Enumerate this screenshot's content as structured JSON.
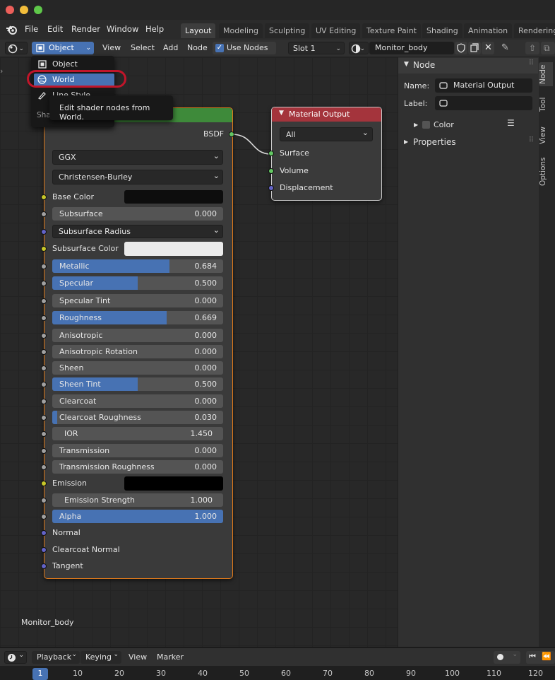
{
  "menubar": {
    "items": [
      "File",
      "Edit",
      "Render",
      "Window",
      "Help"
    ]
  },
  "workspaces": [
    "Layout",
    "Modeling",
    "Sculpting",
    "UV Editing",
    "Texture Paint",
    "Shading",
    "Animation",
    "Rendering"
  ],
  "header": {
    "mode_select": "Object",
    "menus": [
      "View",
      "Select",
      "Add",
      "Node"
    ],
    "use_nodes_label": "Use Nodes",
    "slot": "Slot 1",
    "material_name": "Monitor_body"
  },
  "dropdown": {
    "items": [
      "Object",
      "World",
      "Line Style"
    ],
    "shader_prefix": "Sha",
    "tooltip": "Edit shader nodes from World."
  },
  "bsdf_node": {
    "output_label": "BSDF",
    "distribution": "GGX",
    "subsurface_method": "Christensen-Burley",
    "rows": {
      "base_color": "Base Color",
      "subsurface": {
        "label": "Subsurface",
        "value": "0.000",
        "fraction": 0
      },
      "subsurface_radius": "Subsurface Radius",
      "subsurface_color": "Subsurface Color",
      "metallic": {
        "label": "Metallic",
        "value": "0.684",
        "fraction": 0.684
      },
      "specular": {
        "label": "Specular",
        "value": "0.500",
        "fraction": 0.5
      },
      "specular_tint": {
        "label": "Specular Tint",
        "value": "0.000",
        "fraction": 0
      },
      "roughness": {
        "label": "Roughness",
        "value": "0.669",
        "fraction": 0.669
      },
      "anisotropic": {
        "label": "Anisotropic",
        "value": "0.000",
        "fraction": 0
      },
      "anisotropic_rotation": {
        "label": "Anisotropic Rotation",
        "value": "0.000",
        "fraction": 0
      },
      "sheen": {
        "label": "Sheen",
        "value": "0.000",
        "fraction": 0
      },
      "sheen_tint": {
        "label": "Sheen Tint",
        "value": "0.500",
        "fraction": 0.5
      },
      "clearcoat": {
        "label": "Clearcoat",
        "value": "0.000",
        "fraction": 0
      },
      "clearcoat_roughness": {
        "label": "Clearcoat Roughness",
        "value": "0.030",
        "fraction": 0.03
      },
      "ior": {
        "label": "IOR",
        "value": "1.450",
        "fraction": 0
      },
      "transmission": {
        "label": "Transmission",
        "value": "0.000",
        "fraction": 0
      },
      "transmission_roughness": {
        "label": "Transmission Roughness",
        "value": "0.000",
        "fraction": 0
      },
      "emission": "Emission",
      "emission_strength": {
        "label": "Emission Strength",
        "value": "1.000",
        "fraction": 0
      },
      "alpha": {
        "label": "Alpha",
        "value": "1.000",
        "fraction": 1
      },
      "normal": "Normal",
      "clearcoat_normal": "Clearcoat Normal",
      "tangent": "Tangent"
    }
  },
  "output_node": {
    "title": "Material Output",
    "target": "All",
    "inputs": [
      "Surface",
      "Volume",
      "Displacement"
    ]
  },
  "sidebar": {
    "section": "Node",
    "name_label": "Name:",
    "name_value": "Material Output",
    "label_label": "Label:",
    "color_label": "Color",
    "properties_label": "Properties",
    "tabs": [
      "Node",
      "Tool",
      "View",
      "Options"
    ]
  },
  "canvas_label": "Monitor_body",
  "timeline": {
    "menus": [
      "Playback",
      "Keying",
      "View",
      "Marker"
    ],
    "current_frame": "1",
    "ticks": [
      "10",
      "20",
      "30",
      "40",
      "50",
      "60",
      "70",
      "80",
      "90",
      "100",
      "110",
      "120"
    ]
  },
  "colors": {
    "accent": "#4772b3",
    "highlight_ring": "#c0152a",
    "output_header": "#a4343c",
    "bsdf_header": "#3e8a3a"
  }
}
